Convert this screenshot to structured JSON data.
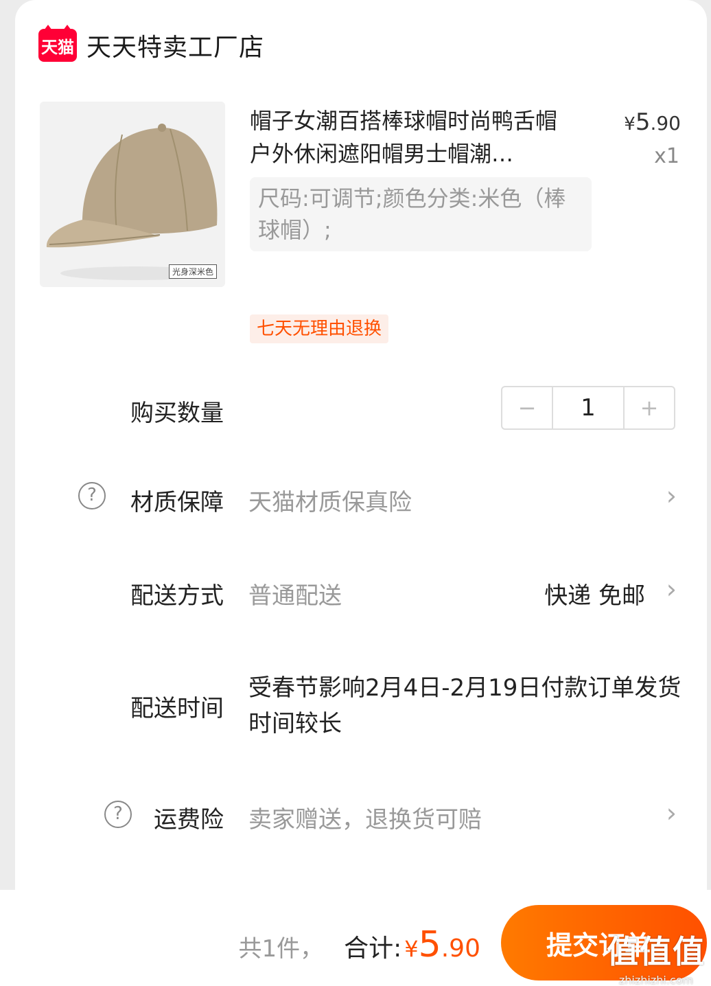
{
  "shop": {
    "logo_text": "天猫",
    "name": "天天特卖工厂店"
  },
  "product": {
    "title": "帽子女潮百搭棒球帽时尚鸭舌帽户外休闲遮阳帽男士帽潮…",
    "price": {
      "currency": "¥",
      "integer": "5",
      "decimal": ".90"
    },
    "quantity_label": "x1",
    "sku": "尺码:可调节;颜色分类:米色（棒球帽）;",
    "image_caption": "光身深米色",
    "tag": "七天无理由退换"
  },
  "quantity": {
    "label": "购买数量",
    "value": "1",
    "minus": "−",
    "plus": "+"
  },
  "material": {
    "label": "材质保障",
    "value": "天猫材质保真险",
    "icon": "question-circle-icon"
  },
  "shipping": {
    "label": "配送方式",
    "value": "普通配送",
    "method": "快递 免邮"
  },
  "delivery_time": {
    "label": "配送时间",
    "value": "受春节影响2月4日-2月19日付款订单发货时间较长"
  },
  "freight_insurance": {
    "label": "运费险",
    "value": "卖家赠送，退换货可赔",
    "icon": "question-circle-icon"
  },
  "footer": {
    "count": "共1件，",
    "total_label": "合计:",
    "total": {
      "currency": "¥",
      "integer": "5",
      "decimal": ".90"
    },
    "submit_label": "提交订单"
  },
  "watermark": {
    "logo": "值值值",
    "url": "zhizhizhi.com"
  },
  "colors": {
    "accent": "#ff5000",
    "tmall_red": "#ff0036"
  }
}
